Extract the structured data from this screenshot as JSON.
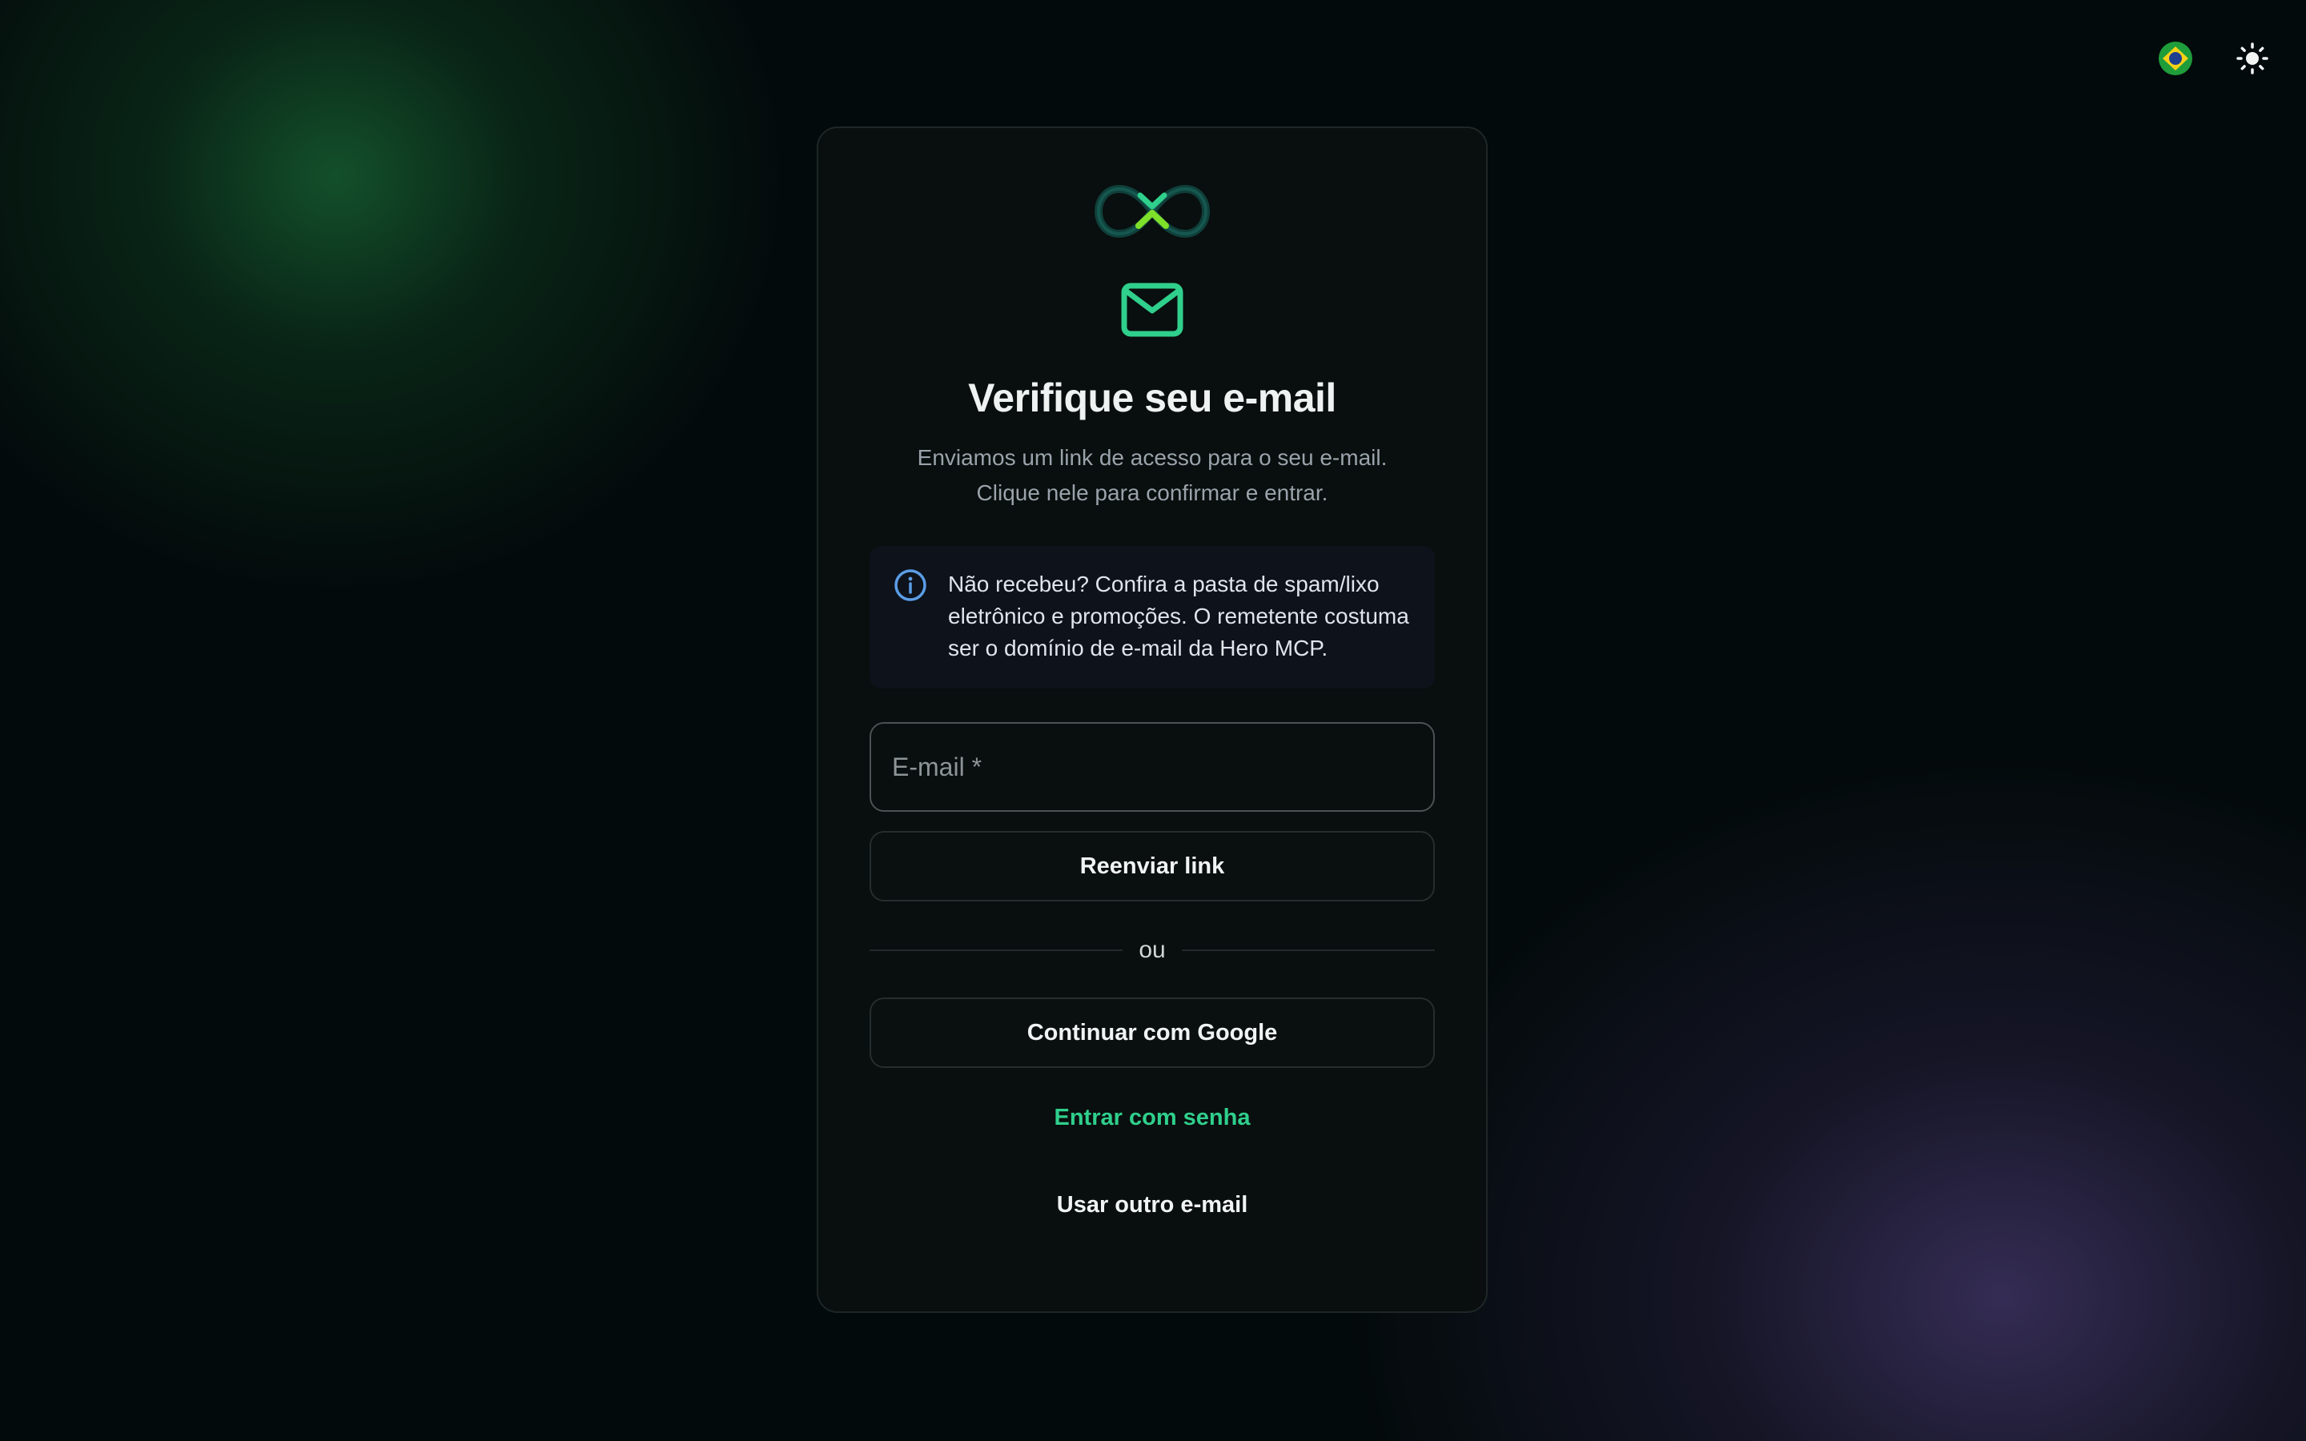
{
  "top_controls": {
    "language_icon": "brazil-flag-icon",
    "theme_icon": "sun-icon"
  },
  "card": {
    "logo_icon": "infinity-logo-icon",
    "mail_icon": "mail-envelope-icon",
    "title": "Verifique seu e-mail",
    "subtitle_line1": "Enviamos um link de acesso para o seu e-mail.",
    "subtitle_line2": "Clique nele para confirmar e entrar.",
    "info": {
      "icon": "info-icon",
      "text": "Não recebeu? Confira a pasta de spam/lixo eletrônico e promoções. O remetente costuma ser o domínio de e-mail da Hero MCP."
    },
    "email_field": {
      "placeholder": "E-mail *",
      "value": ""
    },
    "resend_label": "Reenviar link",
    "divider_text": "ou",
    "google_label": "Continuar com Google",
    "password_link": "Entrar com senha",
    "other_email_link": "Usar outro e-mail"
  },
  "colors": {
    "accent_green": "#2fcf8c",
    "info_blue": "#5b9de6",
    "background": "#030a0b"
  }
}
